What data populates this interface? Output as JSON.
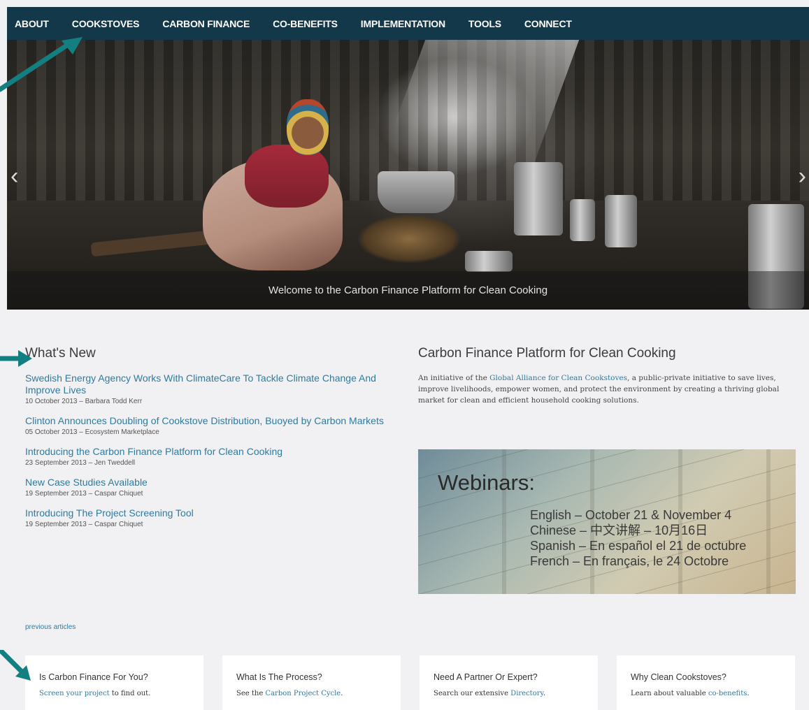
{
  "nav": {
    "items": [
      "ABOUT",
      "COOKSTOVES",
      "CARBON FINANCE",
      "CO-BENEFITS",
      "IMPLEMENTATION",
      "TOOLS",
      "CONNECT"
    ],
    "background": "#12384a"
  },
  "hero": {
    "caption": "Welcome to the Carbon Finance Platform for Clean Cooking",
    "prev_icon": "chevron-left-icon",
    "next_icon": "chevron-right-icon",
    "prev_glyph": "‹",
    "next_glyph": "›"
  },
  "whats_new": {
    "title": "What's New",
    "items": [
      {
        "title": "Swedish Energy Agency Works With ClimateCare To Tackle Climate Change And Improve Lives",
        "meta": "10 October 2013 – Barbara Todd Kerr"
      },
      {
        "title": "Clinton Announces Doubling of Cookstove Distribution, Buoyed by Carbon Markets",
        "meta": "05 October 2013 – Ecosystem Marketplace"
      },
      {
        "title": "Introducing the Carbon Finance Platform for Clean Cooking",
        "meta": "23 September 2013 – Jen Tweddell"
      },
      {
        "title": "New Case Studies Available",
        "meta": "19 September 2013 – Caspar Chiquet"
      },
      {
        "title": "Introducing The Project Screening Tool",
        "meta": "19 September 2013 – Caspar Chiquet"
      }
    ],
    "previous_link": "previous articles"
  },
  "platform": {
    "title": "Carbon Finance Platform for Clean Cooking",
    "desc_before": "An initiative of the ",
    "desc_link": "Global Alliance for Clean Cookstoves",
    "desc_after": ", a public-private initiative to save lives, improve livelihoods, empower women, and protect the environment by creating a thriving global market for clean and efficient household cooking solutions."
  },
  "webinar": {
    "title": "Webinars:",
    "lines": [
      "English – October 21 & November 4",
      "Chinese – 中文讲解 – 10月16日",
      "Spanish – En español el 21 de octubre",
      "French – En français, le 24 Octobre"
    ]
  },
  "cards": [
    {
      "title": "Is Carbon Finance For You?",
      "link": "Screen your project",
      "after": " to find out.",
      "before": ""
    },
    {
      "title": "What Is The Process?",
      "before": "See the ",
      "link": "Carbon Project Cycle",
      "after": "."
    },
    {
      "title": "Need A Partner Or Expert?",
      "before": "Search our extensive ",
      "link": "Directory",
      "after": "."
    },
    {
      "title": "Why Clean Cookstoves?",
      "before": "Learn about valuable ",
      "link": "co-benefits",
      "after": "."
    }
  ],
  "colors": {
    "accent_link": "#2f7a9e",
    "annotation_arrow": "#147f80",
    "page_bg": "#f1f1f3"
  }
}
